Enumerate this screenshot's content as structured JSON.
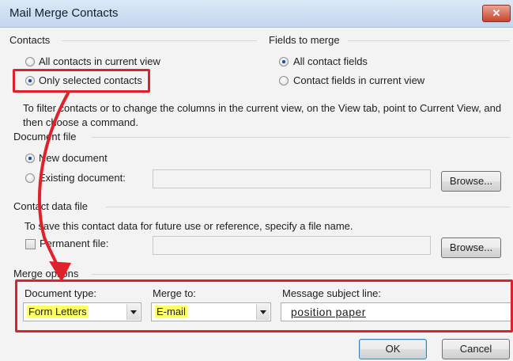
{
  "window": {
    "title": "Mail Merge Contacts",
    "close_label": "✕"
  },
  "contacts": {
    "group_label": "Contacts",
    "options": [
      {
        "label": "All contacts in current view",
        "checked": false
      },
      {
        "label": "Only selected contacts",
        "checked": true
      }
    ]
  },
  "fields_to_merge": {
    "group_label": "Fields to merge",
    "options": [
      {
        "label": "All contact fields",
        "checked": true
      },
      {
        "label": "Contact fields in current view",
        "checked": false
      }
    ]
  },
  "info_text": "To filter contacts or to change the columns in the current view, on the View tab, point to Current View, and then choose a command.",
  "document_file": {
    "group_label": "Document file",
    "options": [
      {
        "label": "New document",
        "checked": true
      },
      {
        "label": "Existing document:",
        "checked": false
      }
    ],
    "existing_value": "",
    "browse_label": "Browse..."
  },
  "contact_data_file": {
    "group_label": "Contact data file",
    "description": "To save this contact data for future use or reference, specify a file name.",
    "permanent_label": "Permanent file:",
    "permanent_checked": false,
    "permanent_value": "",
    "browse_label": "Browse..."
  },
  "merge_options": {
    "group_label": "Merge options",
    "document_type": {
      "label": "Document type:",
      "value": "Form Letters"
    },
    "merge_to": {
      "label": "Merge to:",
      "value": "E-mail"
    },
    "subject": {
      "label": "Message subject line:",
      "value": "position paper"
    }
  },
  "buttons": {
    "ok": "OK",
    "cancel": "Cancel"
  },
  "annotation_color": "#e0212c"
}
